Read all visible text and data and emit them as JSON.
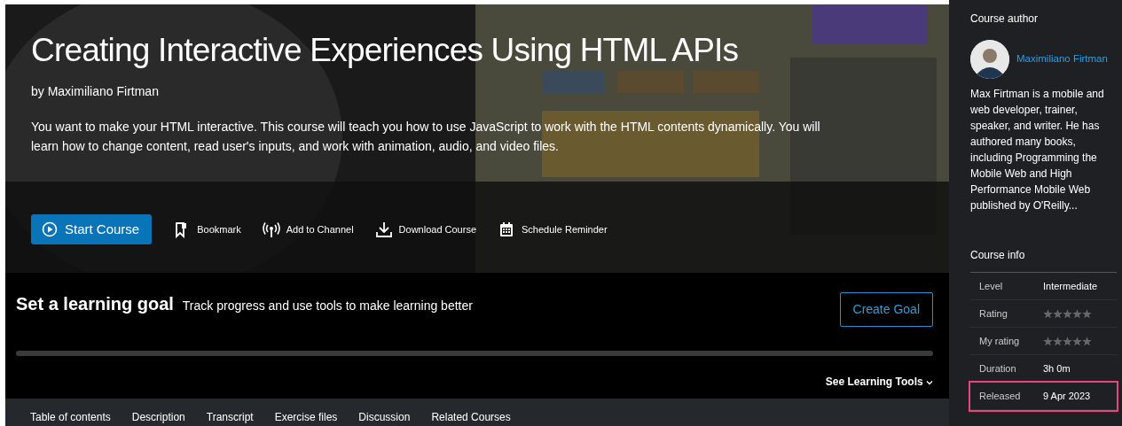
{
  "course": {
    "title": "Creating Interactive Experiences Using HTML APIs",
    "byline": "by Maximiliano Firtman",
    "description": "You want to make your HTML interactive. This course will teach you how to use JavaScript to work with the HTML contents dynamically. You will learn how to change content, read user's inputs, and work with animation, audio, and video files."
  },
  "start_button": "Start Course",
  "actions": [
    {
      "kind": "bookmark",
      "label": "Bookmark"
    },
    {
      "kind": "channel",
      "label": "Add to Channel"
    },
    {
      "kind": "download",
      "label": "Download Course"
    },
    {
      "kind": "calendar",
      "label": "Schedule Reminder"
    }
  ],
  "learning_goal": {
    "title": "Set a learning goal",
    "subtitle": "Track progress and use tools to make learning better",
    "button": "Create Goal",
    "tools_link": "See Learning Tools"
  },
  "tabs": [
    "Table of contents",
    "Description",
    "Transcript",
    "Exercise files",
    "Discussion",
    "Related Courses"
  ],
  "sidebar": {
    "author_heading": "Course author",
    "author_name": "Maximiliano Firtman",
    "author_bio": "Max Firtman is a mobile and web developer, trainer, speaker, and writer. He has authored many books, including Programming the Mobile Web and High Performance Mobile Web published by O'Reilly...",
    "info_heading": "Course info",
    "info": [
      {
        "kind": "text",
        "label": "Level",
        "value": "Intermediate",
        "highlighted": false
      },
      {
        "kind": "stars",
        "label": "Rating",
        "stars": 0,
        "highlighted": false
      },
      {
        "kind": "stars",
        "label": "My rating",
        "stars": 0,
        "highlighted": false
      },
      {
        "kind": "text",
        "label": "Duration",
        "value": "3h 0m",
        "highlighted": false
      },
      {
        "kind": "text",
        "label": "Released",
        "value": "9 Apr 2023",
        "highlighted": true
      }
    ]
  }
}
